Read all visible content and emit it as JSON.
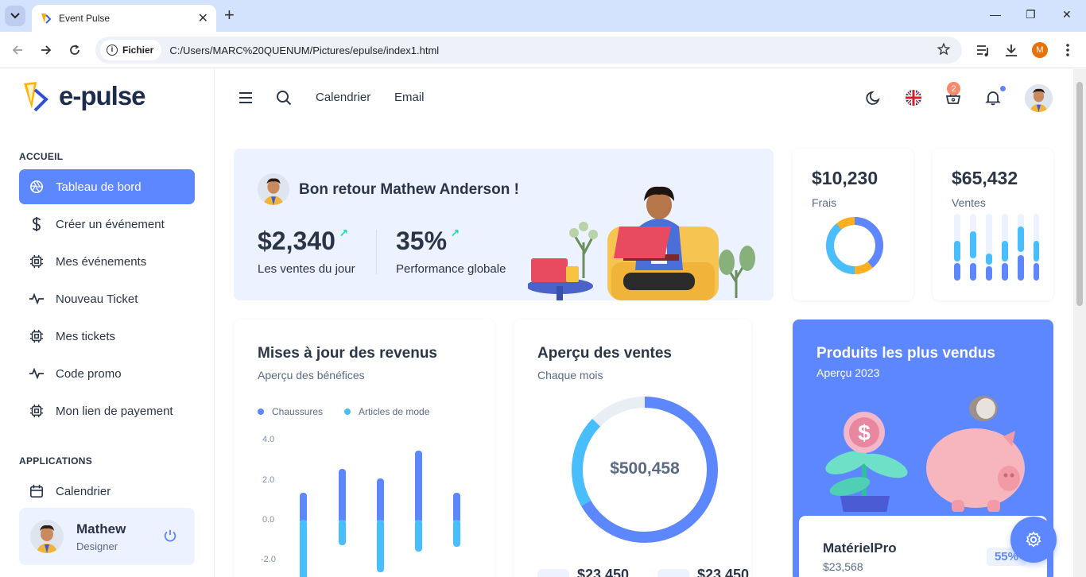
{
  "browser": {
    "tab_title": "Event Pulse",
    "chip_label": "Fichier",
    "url": "C:/Users/MARC%20QUENUM/Pictures/epulse/index1.html",
    "profile_initial": "M"
  },
  "brand": {
    "name": "e-pulse"
  },
  "sidebar": {
    "section_home": "ACCUEIL",
    "items": [
      {
        "label": "Tableau de bord",
        "icon": "aperture-icon"
      },
      {
        "label": "Créer un événement",
        "icon": "dollar-icon"
      },
      {
        "label": "Mes événements",
        "icon": "cpu-icon"
      },
      {
        "label": "Nouveau Ticket",
        "icon": "activity-icon"
      },
      {
        "label": "Mes tickets",
        "icon": "cpu-icon"
      },
      {
        "label": "Code promo",
        "icon": "activity-icon"
      },
      {
        "label": "Mon lien de payement",
        "icon": "cpu-icon"
      }
    ],
    "section_apps": "APPLICATIONS",
    "app_items": [
      {
        "label": "Calendrier",
        "icon": "calendar-icon"
      }
    ],
    "user": {
      "name": "Mathew",
      "role": "Designer"
    }
  },
  "topbar": {
    "links": [
      "Calendrier",
      "Email"
    ],
    "cart_count": "2"
  },
  "welcome": {
    "greeting": "Bon retour Mathew Anderson !",
    "sales_value": "$2,340",
    "sales_label": "Les ventes du jour",
    "perf_value": "35%",
    "perf_label": "Performance globale"
  },
  "stats": {
    "fees": {
      "value": "$10,230",
      "label": "Frais",
      "donut_fraction": 0.78
    },
    "sales": {
      "value": "$65,432",
      "label": "Ventes"
    }
  },
  "revenue": {
    "title": "Mises à jour des revenus",
    "subtitle": "Aperçu des bénéfices",
    "legend": [
      "Chaussures",
      "Articles de mode"
    ],
    "yticks": [
      "4.0",
      "2.0",
      "0.0",
      "-2.0"
    ]
  },
  "sales_overview": {
    "title": "Aperçu des ventes",
    "subtitle": "Chaque mois",
    "center_value": "$500,458",
    "bottom_values": [
      "$23,450",
      "$23,450"
    ]
  },
  "top_products": {
    "title": "Produits les plus vendus",
    "subtitle": "Aperçu 2023",
    "product_name": "MatérielPro",
    "product_price": "$23,568",
    "product_pct": "55%"
  },
  "colors": {
    "primary": "#5d87ff",
    "secondary": "#49beff",
    "success": "#13deb9",
    "text": "#2a3547",
    "light": "#ecf2ff"
  }
}
